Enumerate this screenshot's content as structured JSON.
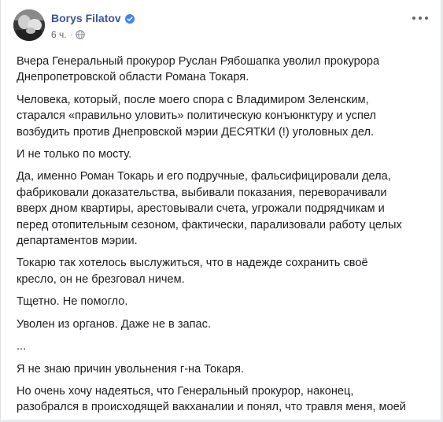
{
  "post": {
    "author": "Borys Filatov",
    "timestamp": "6 ч.",
    "privacy_icon": "globe-icon",
    "verified_icon": "verified-badge-icon",
    "more_icon": "more-options-icon",
    "paragraphs": [
      "Вчера Генеральный прокурор Руслан Рябошапка уволил прокурора\nДнепропетровской области Романа Токаря.",
      "Человека, который, после моего спора с Владимиром Зеленским,\nстарался «правильно уловить» политическую конъюнктуру и успел\nвозбудить против Днепровской мэрии ДЕСЯТКИ (!) уголовных дел.",
      "И не только по мосту.",
      "Да, именно Роман Токарь и его подручные, фальсифицировали дела,\nфабриковали доказательства, выбивали показания, переворачивали\nвверх дном квартиры, арестовывали счета, угрожали подрядчикам и\nперед отопительным сезоном, фактически, парализовали работу целых\nдепартаментов мэрии.",
      "Токарю так хотелось выслужиться, что в надежде сохранить своё\nкресло, он не брезговал ничем.",
      "Тщетно. Не помогло.",
      "Уволен из органов. Даже не в запас.",
      "...",
      "Я не знаю причин увольнения г-на Токаря.",
      "Но очень хочу надеяться, что Генеральный прокурор, наконец,\nразобрался в происходящей вакханалии и понял, что травля меня, моей"
    ]
  },
  "colors": {
    "author_link": "#385898",
    "text": "#1c1e21",
    "secondary": "#616770",
    "verified": "#4080ff"
  }
}
